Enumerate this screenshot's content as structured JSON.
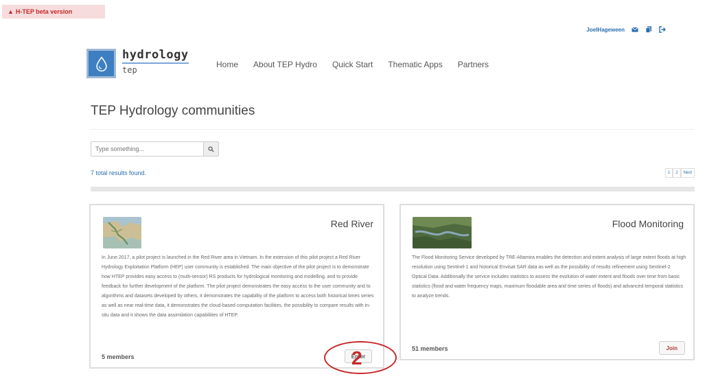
{
  "banner": {
    "text": "H-TEP beta version"
  },
  "user": {
    "name": "JoelHageween"
  },
  "logo": {
    "line1": "hydrology",
    "line2": "tep"
  },
  "nav": [
    "Home",
    "About TEP Hydro",
    "Quick Start",
    "Thematic Apps",
    "Partners"
  ],
  "page": {
    "title": "TEP Hydrology communities"
  },
  "search": {
    "placeholder": "Type something..."
  },
  "results": {
    "text": "7 total results found."
  },
  "pager": {
    "p1": "1",
    "p2": "2",
    "next": "Next"
  },
  "cards": [
    {
      "title": "Red River",
      "description": "In June 2017, a pilot project is launched in the Red River area in Vietnam. In the extension of this pilot project a Red River Hydrology Exploitation Platform (HEP) user community is established. The main objective of the pilot project is to demonstrate how HTEP provides easy access to (multi-sensor) RS products for hydrological monitoring and modelling, and to provide feedback for further development of the platform. The pilot project demonstrates the easy access to the user community and to algorithms and datasets developed by others, it demonstrates the capability of the platform to access both historical times series as well as near real-time data, it demonstrates the cloud-based computation facilities, the possibility to compare results with in-situ data and it shows the data assimilation capabilities of HTEP.",
      "members": "5 members",
      "action": "Enter"
    },
    {
      "title": "Flood Monitoring",
      "description": "The Flood Monitoring Service developed by TRE-Altamira enables the detection and extent analysis of large extent floods at high resolution using Sentinel-1 and historical Envisat SAR data as well as the possibility of results refinement using Sentinel-2 Optical Data. Additionally the service includes statistics to assess the evolution of water extent and floods over time from basic statistics (flood and water frequency maps, maximum floodable area and time series of floods) and advanced temporal statistics to analyze trends.",
      "members": "51 members",
      "action": "Join"
    }
  ],
  "annotation": {
    "number": "2"
  },
  "colors": {
    "link": "#2a6db0",
    "annotation": "#c62828",
    "logo_bg": "#3d7fc0"
  }
}
